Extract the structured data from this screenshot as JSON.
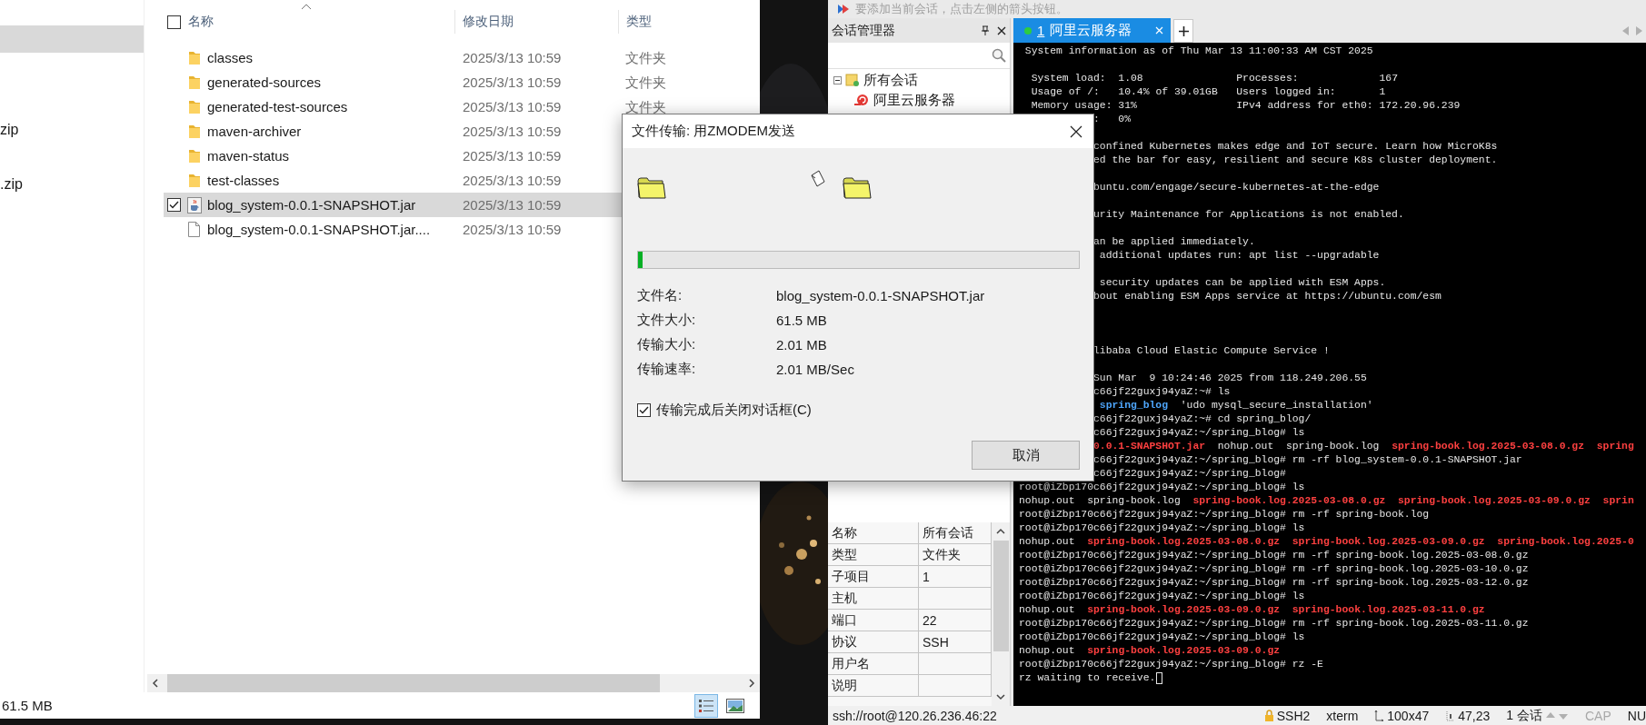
{
  "explorer": {
    "nav_items": [
      {
        "selected": true
      },
      {
        "label": "zip",
        "selected": false
      },
      {
        "label": ".zip",
        "selected": false
      }
    ],
    "select_all": {
      "checked": false
    },
    "columns": [
      "名称",
      "修改日期",
      "类型"
    ],
    "rows": [
      {
        "kind": "folder",
        "name": "classes",
        "date": "2025/3/13 10:59",
        "type": "文件夹",
        "selected": false
      },
      {
        "kind": "folder",
        "name": "generated-sources",
        "date": "2025/3/13 10:59",
        "type": "文件夹",
        "selected": false
      },
      {
        "kind": "folder",
        "name": "generated-test-sources",
        "date": "2025/3/13 10:59",
        "type": "文件夹",
        "selected": false
      },
      {
        "kind": "folder",
        "name": "maven-archiver",
        "date": "2025/3/13 10:59",
        "selected": false
      },
      {
        "kind": "folder",
        "name": "maven-status",
        "date": "2025/3/13 10:59",
        "selected": false
      },
      {
        "kind": "folder",
        "name": "test-classes",
        "date": "2025/3/13 10:59",
        "selected": false
      },
      {
        "kind": "jar",
        "name": "blog_system-0.0.1-SNAPSHOT.jar",
        "date": "2025/3/13 10:59",
        "selected": true
      },
      {
        "kind": "file",
        "name": "blog_system-0.0.1-SNAPSHOT.jar....",
        "date": "2025/3/13 10:59",
        "selected": false
      }
    ],
    "status": "61.5 MB",
    "view_modes": [
      {
        "kind": "details",
        "selected": true
      },
      {
        "kind": "large-icons",
        "selected": false
      }
    ]
  },
  "xshell": {
    "hint": "要添加当前会话，点击左侧的箭头按钮。",
    "session_manager": {
      "title": "会话管理器",
      "tree": [
        {
          "label": "所有会话",
          "expanded": true,
          "children": [
            {
              "label": "阿里云服务器"
            }
          ]
        }
      ],
      "properties": [
        {
          "name": "名称",
          "value": "所有会话"
        },
        {
          "name": "类型",
          "value": "文件夹"
        },
        {
          "name": "子项目",
          "value": "1"
        },
        {
          "name": "主机"
        },
        {
          "name": "端口",
          "value": "22"
        },
        {
          "name": "协议",
          "value": "SSH"
        },
        {
          "name": "用户名"
        },
        {
          "name": "说明"
        }
      ]
    },
    "tabs": [
      {
        "number": "1",
        "label": "阿里云服务器",
        "selected": true
      }
    ],
    "terminal": {
      "cursor": true,
      "lines": [
        {
          "kind": "text",
          "text": " System information as of Thu Mar 13 11:00:33 AM CST 2025",
          "clipped": false
        },
        {
          "kind": "blank"
        },
        {
          "kind": "text",
          "text": "  System load:  1.08               Processes:             167",
          "clipped": false
        },
        {
          "kind": "text",
          "text": "  Usage of /:   10.4% of 39.01GB   Users logged in:       1",
          "clipped": false
        },
        {
          "kind": "text",
          "text": "  Memory usage: 31%                IPv4 address for eth0: 172.20.96.239",
          "clipped": false
        },
        {
          "kind": "text",
          "text": ":   0%",
          "clipped": true
        },
        {
          "kind": "blank"
        },
        {
          "kind": "text",
          "text": "confined Kubernetes makes edge and IoT secure. Learn how MicroK8s",
          "clipped": true
        },
        {
          "kind": "text",
          "text": "ed the bar for easy, resilient and secure K8s cluster deployment.",
          "clipped": true
        },
        {
          "kind": "blank"
        },
        {
          "kind": "text",
          "text": "buntu.com/engage/secure-kubernetes-at-the-edge",
          "clipped": true
        },
        {
          "kind": "blank"
        },
        {
          "kind": "text",
          "text": "urity Maintenance for Applications is not enabled.",
          "clipped": true
        },
        {
          "kind": "blank"
        },
        {
          "kind": "text",
          "text": "an be applied immediately.",
          "clipped": true
        },
        {
          "kind": "text",
          "text": " additional updates run: apt list --upgradable",
          "clipped": true
        },
        {
          "kind": "blank"
        },
        {
          "kind": "text",
          "text": " security updates can be applied with ESM Apps.",
          "clipped": true
        },
        {
          "kind": "text",
          "text": "bout enabling ESM Apps service at https://ubuntu.com/esm",
          "clipped": true
        },
        {
          "kind": "blank"
        },
        {
          "kind": "blank"
        },
        {
          "kind": "blank"
        },
        {
          "kind": "text",
          "text": "libaba Cloud Elastic Compute Service !",
          "clipped": true
        },
        {
          "kind": "blank"
        },
        {
          "kind": "text",
          "text": "Sun Mar  9 10:24:46 2025 from 118.249.206.55",
          "clipped": true
        },
        {
          "kind": "text",
          "text": "c66jf22guxj94yaZ:~# ls",
          "clipped": true
        },
        {
          "kind": "parts",
          "parts": [
            {
              "text": " spring_blog",
              "kind": "dir"
            },
            {
              "text": "  'udo mysql_secure_installation'",
              "kind": "plain"
            }
          ],
          "clipped": true
        },
        {
          "kind": "text",
          "text": "c66jf22guxj94yaZ:~# cd spring_blog/",
          "clipped": true
        },
        {
          "kind": "text",
          "text": "c66jf22guxj94yaZ:~/spring_blog# ls",
          "clipped": true
        },
        {
          "kind": "parts",
          "parts": [
            {
              "text": "0.0.1-SNAPSHOT.jar",
              "kind": "archive"
            },
            {
              "text": "  nohup.out  spring-book.log  ",
              "kind": "plain"
            },
            {
              "text": "spring-book.log.2025-03-08.0.gz  spring",
              "kind": "archive"
            }
          ],
          "clipped": true
        },
        {
          "kind": "text",
          "text": "c66jf22guxj94yaZ:~/spring_blog# rm -rf blog_system-0.0.1-SNAPSHOT.jar",
          "clipped": true
        },
        {
          "kind": "text",
          "text": "c66jf22guxj94yaZ:~/spring_blog#",
          "clipped": true
        },
        {
          "kind": "text",
          "text": "root@iZbp170c66jf22guxj94yaZ:~/spring_blog# ls",
          "clipped": false
        },
        {
          "kind": "parts",
          "parts": [
            {
              "text": "nohup.out  spring-book.log  ",
              "kind": "plain"
            },
            {
              "text": "spring-book.log.2025-03-08.0.gz  spring-book.log.2025-03-09.0.gz  sprin",
              "kind": "archive"
            }
          ],
          "clipped": false
        },
        {
          "kind": "text",
          "text": "root@iZbp170c66jf22guxj94yaZ:~/spring_blog# rm -rf spring-book.log",
          "clipped": false
        },
        {
          "kind": "text",
          "text": "root@iZbp170c66jf22guxj94yaZ:~/spring_blog# ls",
          "clipped": false
        },
        {
          "kind": "parts",
          "parts": [
            {
              "text": "nohup.out  ",
              "kind": "plain"
            },
            {
              "text": "spring-book.log.2025-03-08.0.gz  spring-book.log.2025-03-09.0.gz  spring-book.log.2025-0",
              "kind": "archive"
            }
          ],
          "clipped": false
        },
        {
          "kind": "text",
          "text": "root@iZbp170c66jf22guxj94yaZ:~/spring_blog# rm -rf spring-book.log.2025-03-08.0.gz",
          "clipped": false
        },
        {
          "kind": "text",
          "text": "root@iZbp170c66jf22guxj94yaZ:~/spring_blog# rm -rf spring-book.log.2025-03-10.0.gz",
          "clipped": false
        },
        {
          "kind": "text",
          "text": "root@iZbp170c66jf22guxj94yaZ:~/spring_blog# rm -rf spring-book.log.2025-03-12.0.gz",
          "clipped": false
        },
        {
          "kind": "text",
          "text": "root@iZbp170c66jf22guxj94yaZ:~/spring_blog# ls",
          "clipped": false
        },
        {
          "kind": "parts",
          "parts": [
            {
              "text": "nohup.out  ",
              "kind": "plain"
            },
            {
              "text": "spring-book.log.2025-03-09.0.gz  spring-book.log.2025-03-11.0.gz",
              "kind": "archive"
            }
          ],
          "clipped": false
        },
        {
          "kind": "text",
          "text": "root@iZbp170c66jf22guxj94yaZ:~/spring_blog# rm -rf spring-book.log.2025-03-11.0.gz",
          "clipped": false
        },
        {
          "kind": "text",
          "text": "root@iZbp170c66jf22guxj94yaZ:~/spring_blog# ls",
          "clipped": false
        },
        {
          "kind": "parts",
          "parts": [
            {
              "text": "nohup.out  ",
              "kind": "plain"
            },
            {
              "text": "spring-book.log.2025-03-09.0.gz",
              "kind": "archive"
            }
          ],
          "clipped": false
        },
        {
          "kind": "text",
          "text": "root@iZbp170c66jf22guxj94yaZ:~/spring_blog# rz -E",
          "clipped": false
        },
        {
          "kind": "text",
          "text": "rz waiting to receive.",
          "clipped": false
        }
      ]
    },
    "status_bar": {
      "connection": "ssh://root@120.26.236.46:22",
      "items": [
        {
          "kind": "protocol",
          "text": "SSH2",
          "on": true
        },
        {
          "kind": "terminal",
          "text": "xterm",
          "on": true
        },
        {
          "kind": "size",
          "text": "100x47",
          "on": true
        },
        {
          "kind": "cursor",
          "text": "47,23",
          "on": true
        },
        {
          "kind": "sessions",
          "text": "1 会话",
          "on": true
        },
        {
          "kind": "lock",
          "text": "CAP",
          "on": false
        },
        {
          "kind": "lock",
          "text": "NU",
          "on": true
        }
      ]
    }
  },
  "dialog": {
    "title": "文件传输: 用ZMODEM发送",
    "progress": {
      "level": 0.011
    },
    "fields": [
      {
        "label": "文件名:",
        "value": "blog_system-0.0.1-SNAPSHOT.jar"
      },
      {
        "label": "文件大小:",
        "value": "61.5 MB"
      },
      {
        "label": "传输大小:",
        "value": "2.01 MB"
      },
      {
        "label": "传输速率:",
        "value": "2.01 MB/Sec"
      }
    ],
    "close_when_done": {
      "label": "传输完成后关闭对话框(C)",
      "checked": true
    },
    "buttons": [
      "取消"
    ]
  }
}
